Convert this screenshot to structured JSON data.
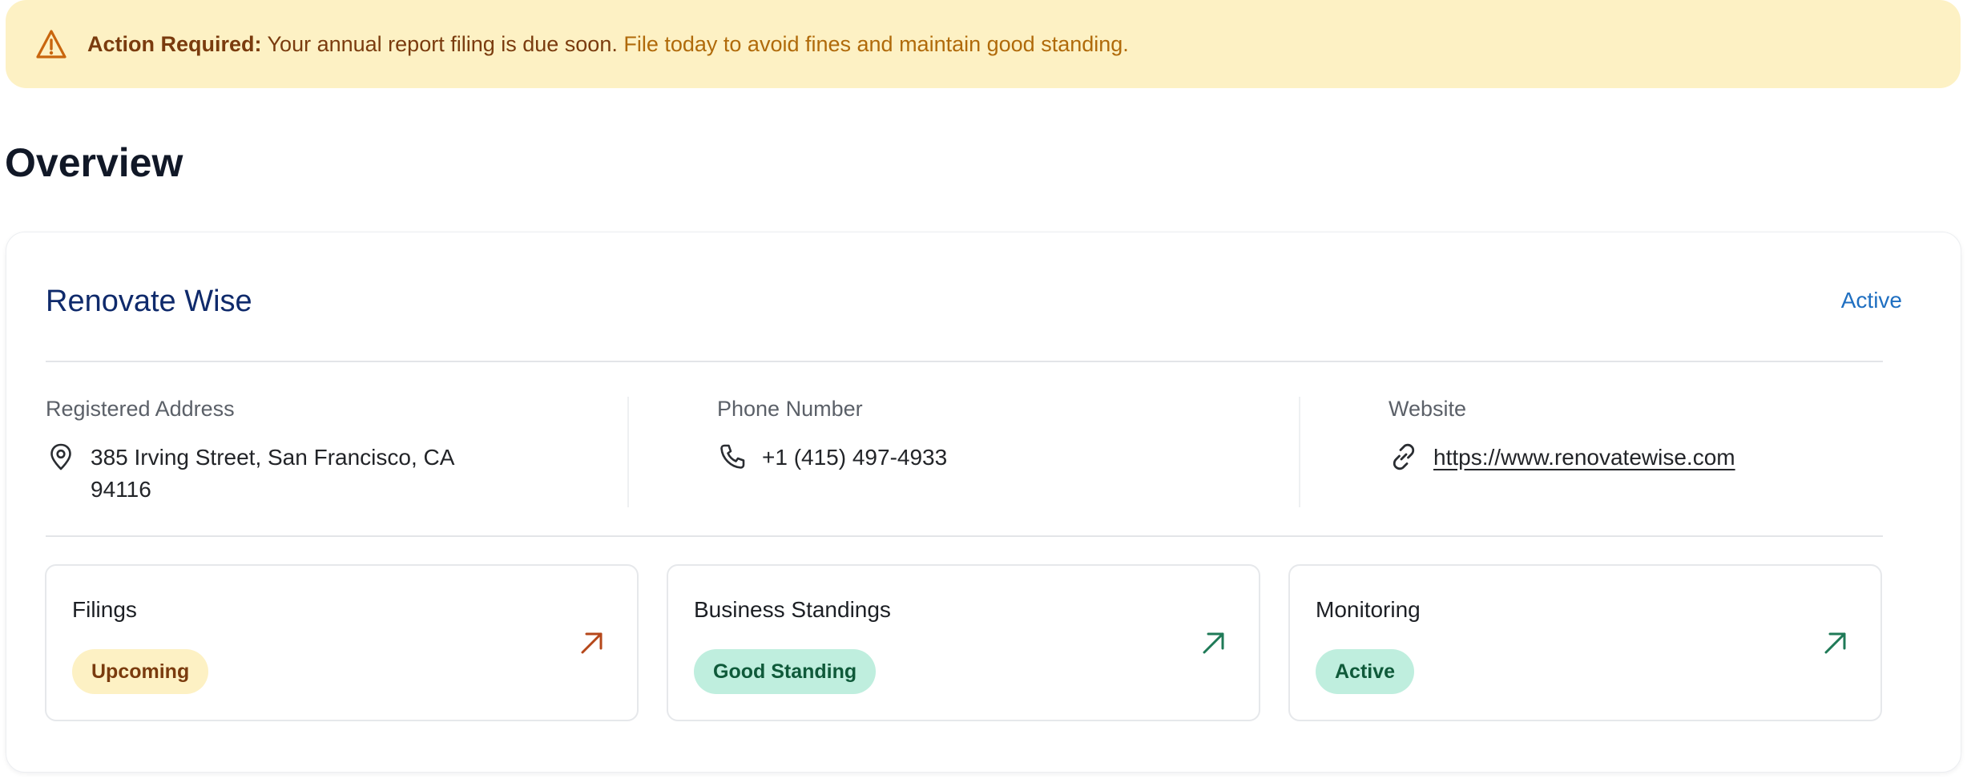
{
  "alert": {
    "icon": "warning-triangle-icon",
    "strong": "Action Required:",
    "message": "Your annual report filing is due soon.",
    "cta": "File today to avoid fines and maintain good standing.",
    "colors": {
      "background": "#fdf1c4",
      "text": "#7a3b0e",
      "cta": "#b06a0a"
    }
  },
  "page": {
    "title": "Overview"
  },
  "company": {
    "name": "Renovate Wise",
    "status": "Active",
    "address": {
      "label": "Registered Address",
      "line1": "385 Irving Street, San Francisco, CA",
      "line2": "94116",
      "icon": "map-pin-icon"
    },
    "phone": {
      "label": "Phone Number",
      "value": "+1 (415) 497-4933",
      "icon": "phone-icon"
    },
    "website": {
      "label": "Website",
      "value": "https://www.renovatewise.com",
      "icon": "link-icon"
    }
  },
  "tiles": [
    {
      "title": "Filings",
      "badge": "Upcoming",
      "badge_color": "#fdf1c4",
      "arrow_color": "#b5471a",
      "icon": "arrow-up-right-icon"
    },
    {
      "title": "Business Standings",
      "badge": "Good Standing",
      "badge_color": "#bfeede",
      "arrow_color": "#1f7a57",
      "icon": "arrow-up-right-icon"
    },
    {
      "title": "Monitoring",
      "badge": "Active",
      "badge_color": "#bfeede",
      "arrow_color": "#1f7a57",
      "icon": "arrow-up-right-icon"
    }
  ]
}
